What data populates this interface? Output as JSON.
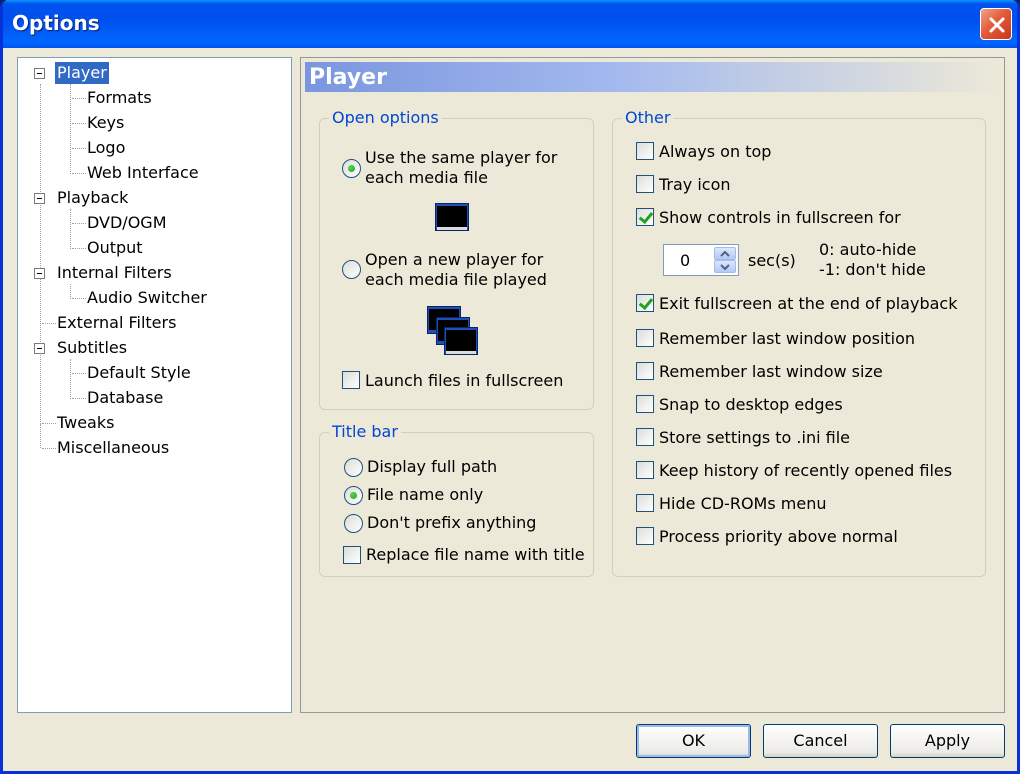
{
  "window": {
    "title": "Options"
  },
  "tree": {
    "items": [
      {
        "label": "Player",
        "selected": true
      },
      {
        "label": "Formats"
      },
      {
        "label": "Keys"
      },
      {
        "label": "Logo"
      },
      {
        "label": "Web Interface"
      },
      {
        "label": "Playback"
      },
      {
        "label": "DVD/OGM"
      },
      {
        "label": "Output"
      },
      {
        "label": "Internal Filters"
      },
      {
        "label": "Audio Switcher"
      },
      {
        "label": "External Filters"
      },
      {
        "label": "Subtitles"
      },
      {
        "label": "Default Style"
      },
      {
        "label": "Database"
      },
      {
        "label": "Tweaks"
      },
      {
        "label": "Miscellaneous"
      }
    ]
  },
  "panel": {
    "header": "Player"
  },
  "open_options": {
    "legend": "Open options",
    "same_player_line1": "Use the same player for",
    "same_player_line2": "each media file",
    "same_player_checked": true,
    "new_player_line1": "Open a new player for",
    "new_player_line2": "each media file played",
    "new_player_checked": false,
    "launch_fullscreen": "Launch files in fullscreen",
    "launch_fullscreen_checked": false
  },
  "title_bar": {
    "legend": "Title bar",
    "full_path": "Display full path",
    "file_name_only": "File name only",
    "dont_prefix": "Don't prefix anything",
    "selected": "File name only",
    "replace_title": "Replace file name with title",
    "replace_title_checked": false
  },
  "other": {
    "legend": "Other",
    "always_on_top": "Always on top",
    "tray_icon": "Tray icon",
    "show_controls": "Show controls in fullscreen for",
    "spin_value": "0",
    "spin_unit": "sec(s)",
    "hint_line1": "0: auto-hide",
    "hint_line2": "-1: don't hide",
    "exit_fullscreen": "Exit fullscreen at the end of playback",
    "remember_position": "Remember last window position",
    "remember_size": "Remember last window size",
    "snap_edges": "Snap to desktop edges",
    "store_ini": "Store settings to .ini file",
    "keep_history": "Keep history of recently opened files",
    "hide_cdrom": "Hide CD-ROMs menu",
    "process_priority": "Process priority above normal"
  },
  "buttons": {
    "ok": "OK",
    "cancel": "Cancel",
    "apply": "Apply"
  },
  "colors": {
    "accent": "#0046d5",
    "selection": "#316ac5",
    "titlebar": "#0053ee",
    "check": "#21a121"
  }
}
